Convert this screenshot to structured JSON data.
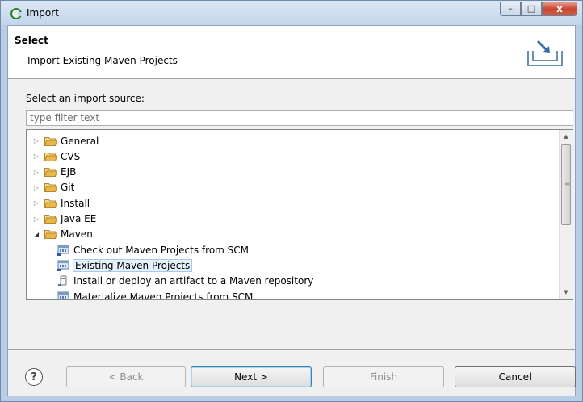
{
  "window": {
    "title": "Import",
    "controls": {
      "minimize": "–",
      "maximize": "□",
      "close": "x"
    }
  },
  "banner": {
    "title": "Select",
    "description": "Import Existing Maven Projects"
  },
  "source": {
    "label": "Select an import source:",
    "filter_placeholder": "type filter text"
  },
  "tree": {
    "items": [
      {
        "label": "General",
        "icon": "folder-icon",
        "expanded": false,
        "level": 0
      },
      {
        "label": "CVS",
        "icon": "folder-icon",
        "expanded": false,
        "level": 0
      },
      {
        "label": "EJB",
        "icon": "folder-icon",
        "expanded": false,
        "level": 0
      },
      {
        "label": "Git",
        "icon": "folder-icon",
        "expanded": false,
        "level": 0
      },
      {
        "label": "Install",
        "icon": "folder-icon",
        "expanded": false,
        "level": 0
      },
      {
        "label": "Java EE",
        "icon": "folder-icon",
        "expanded": false,
        "level": 0
      },
      {
        "label": "Maven",
        "icon": "folder-icon",
        "expanded": true,
        "level": 0
      },
      {
        "label": "Check out Maven Projects from SCM",
        "icon": "maven-project-icon",
        "level": 1
      },
      {
        "label": "Existing Maven Projects",
        "icon": "maven-project-icon",
        "level": 1,
        "selected": true
      },
      {
        "label": "Install or deploy an artifact to a Maven repository",
        "icon": "jar-icon",
        "level": 1
      },
      {
        "label": "Materialize Maven Projects from SCM",
        "icon": "maven-project-icon",
        "level": 1
      }
    ]
  },
  "buttons": {
    "help": "?",
    "back": "< Back",
    "next": "Next >",
    "finish": "Finish",
    "cancel": "Cancel"
  },
  "colors": {
    "folder": "#e8b84a",
    "selection": "#e5f1fb",
    "default_button_border": "#3c7fb1"
  }
}
